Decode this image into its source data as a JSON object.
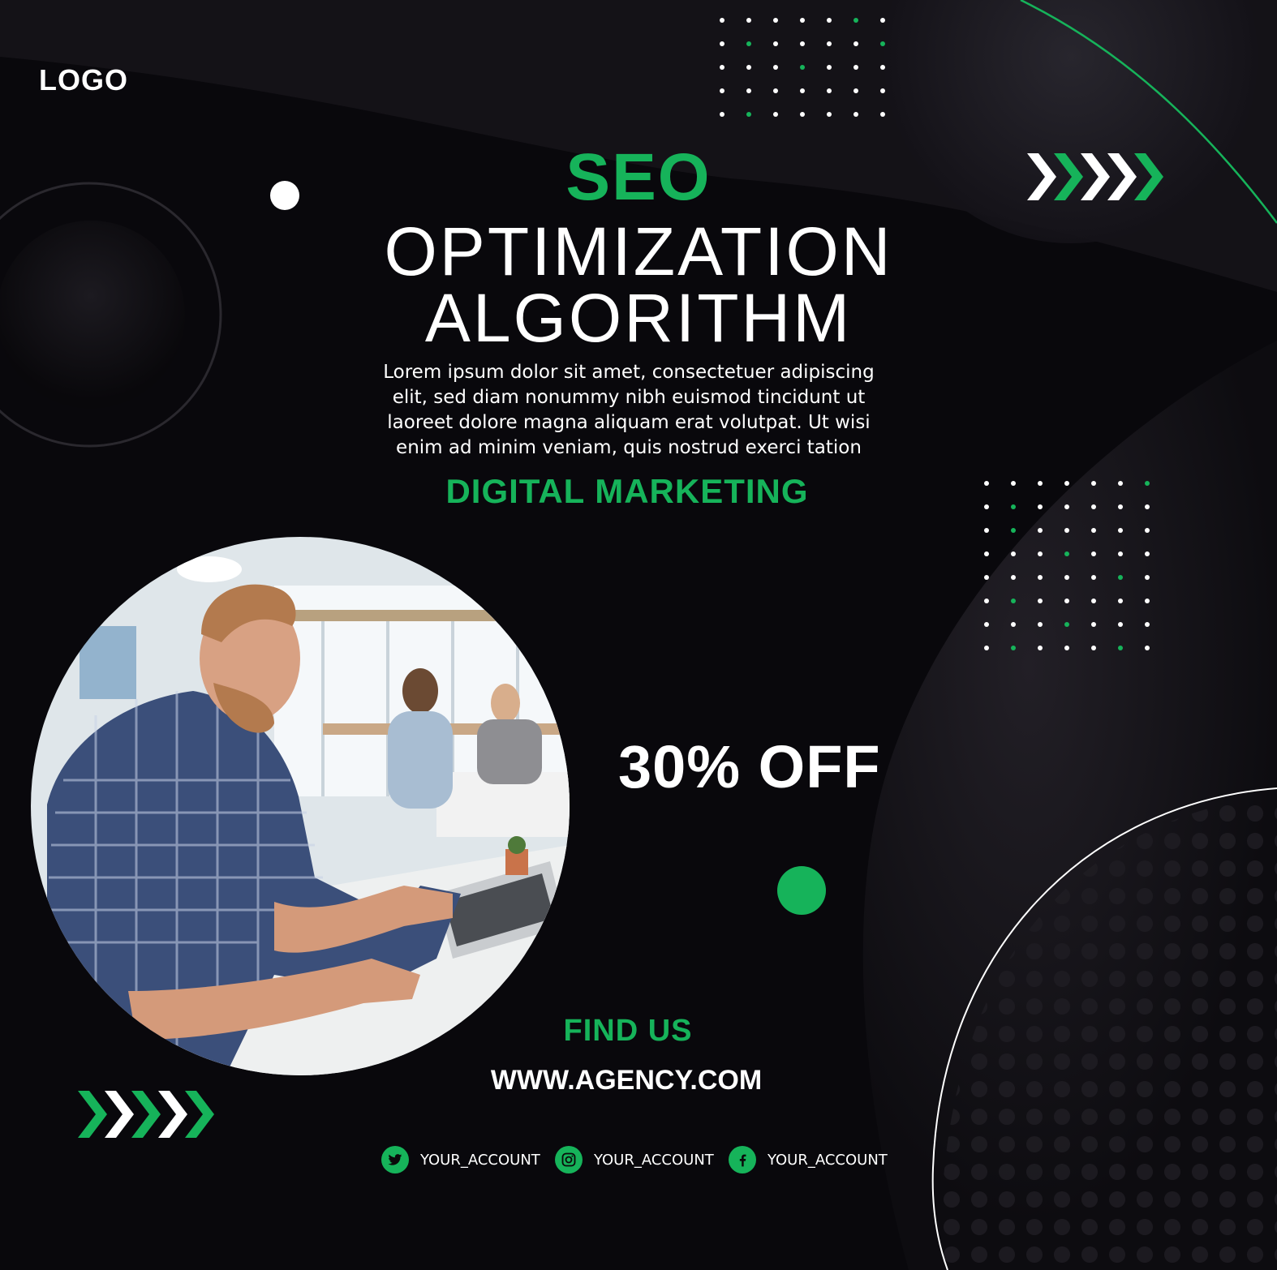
{
  "logo": "LOGO",
  "headline": {
    "keyword": "SEO",
    "line1": "OPTIMIZATION",
    "line2": "ALGORITHM"
  },
  "description": "Lorem ipsum dolor sit amet, consectetuer adipiscing elit, sed diam nonummy nibh euismod tincidunt ut laoreet dolore magna aliquam erat volutpat. Ut wisi enim ad minim veniam, quis nostrud exerci tation",
  "tagline": "DIGITAL MARKETING",
  "offer": "30% OFF",
  "contact": {
    "heading": "FIND US",
    "website": "WWW.AGENCY.COM"
  },
  "socials": [
    {
      "icon": "twitter-icon",
      "label": "YOUR_ACCOUNT"
    },
    {
      "icon": "instagram-icon",
      "label": "YOUR_ACCOUNT"
    },
    {
      "icon": "facebook-icon",
      "label": "YOUR_ACCOUNT"
    }
  ],
  "colors": {
    "accent": "#16b35a",
    "background": "#09080c",
    "text": "#ffffff"
  }
}
